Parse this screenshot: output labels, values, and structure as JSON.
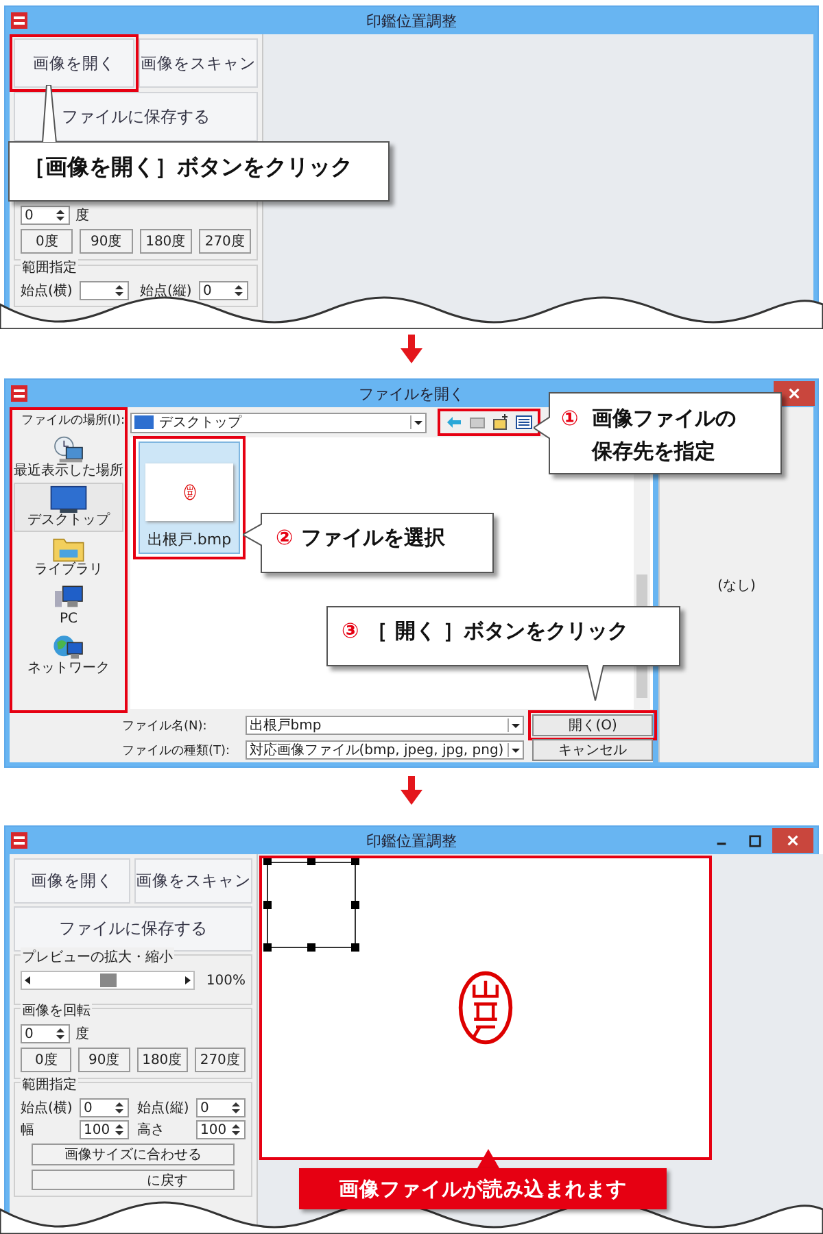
{
  "step1": {
    "window": {
      "title": "印鑑位置調整"
    },
    "buttons": {
      "open": "画像を開く",
      "scan": "画像をスキャン",
      "save": "ファイルに保存する"
    },
    "rotate": {
      "value": "0",
      "unit": "度",
      "buttons": [
        "0度",
        "90度",
        "180度",
        "270度"
      ]
    },
    "range": {
      "title": "範囲指定",
      "fields": [
        {
          "label": "始点(横)"
        },
        {
          "label": "始点(縦)",
          "value": "0"
        }
      ]
    },
    "callout": "［画像を開く］ボタンをクリック"
  },
  "step2": {
    "window": {
      "title": "ファイルを開く"
    },
    "location": {
      "label": "ファイルの場所(I):",
      "value": "デスクトップ"
    },
    "places": [
      {
        "kind": "recent",
        "label": "最近表示した場所",
        "selected": false
      },
      {
        "kind": "desktop",
        "label": "デスクトップ",
        "selected": true
      },
      {
        "kind": "library",
        "label": "ライブラリ",
        "selected": false
      },
      {
        "kind": "pc",
        "label": "PC",
        "selected": false
      },
      {
        "kind": "network",
        "label": "ネットワーク",
        "selected": false
      }
    ],
    "files": [
      {
        "name": "出根戸.bmp",
        "selected": true
      }
    ],
    "preview": "(なし)",
    "filename": {
      "label": "ファイル名(N):",
      "value": "出根戸bmp"
    },
    "filetype": {
      "label": "ファイルの種類(T):",
      "value": "対応画像ファイル(bmp, jpeg, jpg, png)"
    },
    "buttons": {
      "open": "開く(O)",
      "cancel": "キャンセル"
    },
    "callouts": [
      {
        "number": "①",
        "text": "画像ファイルの保存先を指定"
      },
      {
        "number": "②",
        "text": "ファイルを選択"
      },
      {
        "number": "③",
        "text": "［ 開く ］ボタンをクリック"
      }
    ]
  },
  "step3": {
    "window": {
      "title": "印鑑位置調整"
    },
    "buttons": {
      "open": "画像を開く",
      "scan": "画像をスキャン",
      "save": "ファイルに保存する"
    },
    "zoom": {
      "title": "プレビューの拡大・縮小",
      "level": 0.5,
      "reading": "100%"
    },
    "rotate": {
      "title": "画像を回転",
      "value": "0",
      "unit": "度",
      "buttons": [
        "0度",
        "90度",
        "180度",
        "270度"
      ]
    },
    "range": {
      "title": "範囲指定",
      "fields": [
        {
          "label": "始点(横)",
          "value": "0"
        },
        {
          "label": "始点(縦)",
          "value": "0"
        },
        {
          "label": "幅",
          "value": "100"
        },
        {
          "label": "高さ",
          "value": "100"
        }
      ],
      "buttons": [
        "画像サイズに合わせる",
        "に戻す"
      ]
    },
    "callout": "画像ファイルが読み込まれます"
  }
}
